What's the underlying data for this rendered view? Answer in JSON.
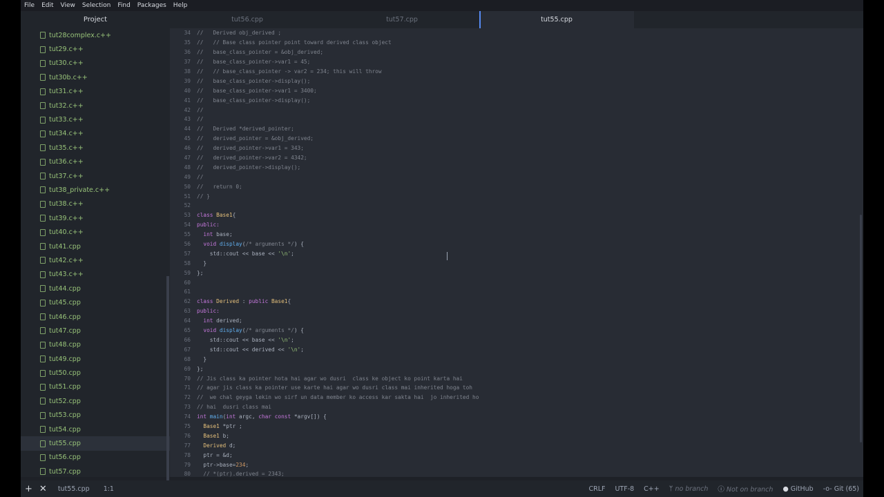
{
  "menu": [
    "File",
    "Edit",
    "View",
    "Selection",
    "Find",
    "Packages",
    "Help"
  ],
  "tree": {
    "header": "Project",
    "items": [
      "tut28complex.c++",
      "tut29.c++",
      "tut30.c++",
      "tut30b.c++",
      "tut31.c++",
      "tut32.c++",
      "tut33.c++",
      "tut34.c++",
      "tut35.c++",
      "tut36.c++",
      "tut37.c++",
      "tut38_private.c++",
      "tut38.c++",
      "tut39.c++",
      "tut40.c++",
      "tut41.cpp",
      "tut42.c++",
      "tut43.c++",
      "tut44.cpp",
      "tut45.cpp",
      "tut46.cpp",
      "tut47.cpp",
      "tut48.cpp",
      "tut49.cpp",
      "tut50.cpp",
      "tut51.cpp",
      "tut52.cpp",
      "tut53.cpp",
      "tut54.cpp",
      "tut55.cpp",
      "tut56.cpp",
      "tut57.cpp"
    ],
    "selected": "tut55.cpp"
  },
  "tabs": [
    {
      "label": "tut56.cpp",
      "active": false
    },
    {
      "label": "tut57.cpp",
      "active": false
    },
    {
      "label": "tut55.cpp",
      "active": true
    }
  ],
  "code": [
    {
      "n": "34",
      "tokens": [
        {
          "t": "//   Derived obj_derived ;",
          "c": "com"
        }
      ]
    },
    {
      "n": "35",
      "tokens": [
        {
          "t": "//   // Base class pointer point toward derived class object",
          "c": "com"
        }
      ]
    },
    {
      "n": "36",
      "tokens": [
        {
          "t": "//   base_class_pointer = &obj_derived;",
          "c": "com"
        }
      ]
    },
    {
      "n": "37",
      "tokens": [
        {
          "t": "//   base_class_pointer->var1 = 45;",
          "c": "com"
        }
      ]
    },
    {
      "n": "38",
      "tokens": [
        {
          "t": "//   // base_class_pointer -> var2 = 234; this will throw",
          "c": "com"
        }
      ]
    },
    {
      "n": "39",
      "tokens": [
        {
          "t": "//   base_class_pointer->display();",
          "c": "com"
        }
      ]
    },
    {
      "n": "40",
      "tokens": [
        {
          "t": "//   base_class_pointer->var1 = 3400;",
          "c": "com"
        }
      ]
    },
    {
      "n": "41",
      "tokens": [
        {
          "t": "//   base_class_pointer->display();",
          "c": "com"
        }
      ]
    },
    {
      "n": "42",
      "tokens": [
        {
          "t": "//",
          "c": "com"
        }
      ]
    },
    {
      "n": "43",
      "tokens": [
        {
          "t": "//",
          "c": "com"
        }
      ]
    },
    {
      "n": "44",
      "tokens": [
        {
          "t": "//   Derived *derived_pointer;",
          "c": "com"
        }
      ]
    },
    {
      "n": "45",
      "tokens": [
        {
          "t": "//   derived_pointer = &obj_derived;",
          "c": "com"
        }
      ]
    },
    {
      "n": "46",
      "tokens": [
        {
          "t": "//   derived_pointer->var1 = 343;",
          "c": "com"
        }
      ]
    },
    {
      "n": "47",
      "tokens": [
        {
          "t": "//   derived_pointer->var2 = 4342;",
          "c": "com"
        }
      ]
    },
    {
      "n": "48",
      "tokens": [
        {
          "t": "//   derived_pointer->display();",
          "c": "com"
        }
      ]
    },
    {
      "n": "49",
      "tokens": [
        {
          "t": "//",
          "c": "com"
        }
      ]
    },
    {
      "n": "50",
      "tokens": [
        {
          "t": "//   return 0;",
          "c": "com"
        }
      ]
    },
    {
      "n": "51",
      "tokens": [
        {
          "t": "// }",
          "c": "com"
        }
      ]
    },
    {
      "n": "52",
      "tokens": []
    },
    {
      "n": "53",
      "tokens": [
        {
          "t": "class ",
          "c": "kw"
        },
        {
          "t": "Base1",
          "c": "type"
        },
        {
          "t": "{",
          "c": "plain"
        }
      ]
    },
    {
      "n": "54",
      "tokens": [
        {
          "t": "public:",
          "c": "kw"
        }
      ]
    },
    {
      "n": "55",
      "tokens": [
        {
          "t": "  ",
          "c": "plain"
        },
        {
          "t": "int ",
          "c": "kw"
        },
        {
          "t": "base;",
          "c": "plain"
        }
      ]
    },
    {
      "n": "56",
      "tokens": [
        {
          "t": "  ",
          "c": "plain"
        },
        {
          "t": "void ",
          "c": "kw"
        },
        {
          "t": "display",
          "c": "fn"
        },
        {
          "t": "(",
          "c": "plain"
        },
        {
          "t": "/* arguments */",
          "c": "com"
        },
        {
          "t": ") {",
          "c": "plain"
        }
      ]
    },
    {
      "n": "57",
      "tokens": [
        {
          "t": "    std::cout << base << ",
          "c": "plain"
        },
        {
          "t": "'\\n'",
          "c": "str"
        },
        {
          "t": ";",
          "c": "plain"
        }
      ]
    },
    {
      "n": "58",
      "tokens": [
        {
          "t": "  }",
          "c": "plain"
        }
      ]
    },
    {
      "n": "59",
      "tokens": [
        {
          "t": "};",
          "c": "plain"
        }
      ]
    },
    {
      "n": "60",
      "tokens": []
    },
    {
      "n": "61",
      "tokens": []
    },
    {
      "n": "62",
      "tokens": [
        {
          "t": "class ",
          "c": "kw"
        },
        {
          "t": "Derived",
          "c": "type"
        },
        {
          "t": " : ",
          "c": "plain"
        },
        {
          "t": "public ",
          "c": "kw"
        },
        {
          "t": "Base1",
          "c": "type"
        },
        {
          "t": "{",
          "c": "plain"
        }
      ]
    },
    {
      "n": "63",
      "tokens": [
        {
          "t": "public:",
          "c": "kw"
        }
      ]
    },
    {
      "n": "64",
      "tokens": [
        {
          "t": "  ",
          "c": "plain"
        },
        {
          "t": "int ",
          "c": "kw"
        },
        {
          "t": "derived;",
          "c": "plain"
        }
      ]
    },
    {
      "n": "65",
      "tokens": [
        {
          "t": "  ",
          "c": "plain"
        },
        {
          "t": "void ",
          "c": "kw"
        },
        {
          "t": "display",
          "c": "fn"
        },
        {
          "t": "(",
          "c": "plain"
        },
        {
          "t": "/* arguments */",
          "c": "com"
        },
        {
          "t": ") {",
          "c": "plain"
        }
      ]
    },
    {
      "n": "66",
      "tokens": [
        {
          "t": "    std::cout << base << ",
          "c": "plain"
        },
        {
          "t": "'\\n'",
          "c": "str"
        },
        {
          "t": ";",
          "c": "plain"
        }
      ]
    },
    {
      "n": "67",
      "tokens": [
        {
          "t": "    std::cout << derived << ",
          "c": "plain"
        },
        {
          "t": "'\\n'",
          "c": "str"
        },
        {
          "t": ";",
          "c": "plain"
        }
      ]
    },
    {
      "n": "68",
      "tokens": [
        {
          "t": "  }",
          "c": "plain"
        }
      ]
    },
    {
      "n": "69",
      "tokens": [
        {
          "t": "};",
          "c": "plain"
        }
      ]
    },
    {
      "n": "70",
      "tokens": [
        {
          "t": "// Jis class ka pointer hota hai agar wo dusri  class ke object ko point karta hai",
          "c": "com"
        }
      ]
    },
    {
      "n": "71",
      "tokens": [
        {
          "t": "// agar jis class ka pointer use karte hai agar wo dusri class mai inherited hoga toh",
          "c": "com"
        }
      ]
    },
    {
      "n": "72",
      "tokens": [
        {
          "t": "//  we chal geyga lekin wo sirf un data member ko access kar sakta hai  jo inherited ho",
          "c": "com"
        }
      ]
    },
    {
      "n": "73",
      "tokens": [
        {
          "t": "// hai  dusri class mai",
          "c": "com"
        }
      ]
    },
    {
      "n": "74",
      "tokens": [
        {
          "t": "int ",
          "c": "kw"
        },
        {
          "t": "main",
          "c": "fn"
        },
        {
          "t": "(",
          "c": "plain"
        },
        {
          "t": "int ",
          "c": "kw"
        },
        {
          "t": "argc, ",
          "c": "plain"
        },
        {
          "t": "char const ",
          "c": "kw"
        },
        {
          "t": "*argv[]) {",
          "c": "plain"
        }
      ]
    },
    {
      "n": "75",
      "tokens": [
        {
          "t": "  ",
          "c": "plain"
        },
        {
          "t": "Base1",
          "c": "type"
        },
        {
          "t": " *ptr ;",
          "c": "plain"
        }
      ]
    },
    {
      "n": "76",
      "tokens": [
        {
          "t": "  ",
          "c": "plain"
        },
        {
          "t": "Base1",
          "c": "type"
        },
        {
          "t": " b;",
          "c": "plain"
        }
      ]
    },
    {
      "n": "77",
      "tokens": [
        {
          "t": "  ",
          "c": "plain"
        },
        {
          "t": "Derived",
          "c": "type"
        },
        {
          "t": " d;",
          "c": "plain"
        }
      ]
    },
    {
      "n": "78",
      "tokens": [
        {
          "t": "  ptr = &d;",
          "c": "plain"
        }
      ]
    },
    {
      "n": "79",
      "tokens": [
        {
          "t": "  ptr->base=",
          "c": "plain"
        },
        {
          "t": "234",
          "c": "num"
        },
        {
          "t": ";",
          "c": "plain"
        }
      ]
    },
    {
      "n": "80",
      "tokens": [
        {
          "t": "  // *(ptr).derived = 2343;",
          "c": "com"
        }
      ]
    }
  ],
  "status": {
    "file": "tut55.cpp",
    "cursor": "1:1",
    "line_ending": "CRLF",
    "encoding": "UTF-8",
    "grammar": "C++",
    "branch": "no branch",
    "not_on_branch": "Not on branch",
    "github": "GitHub",
    "git": "Git (65)"
  }
}
